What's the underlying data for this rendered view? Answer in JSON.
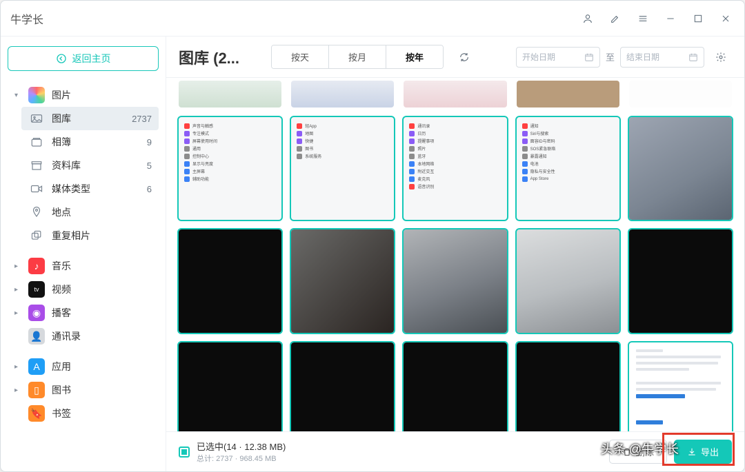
{
  "app_name": "牛学长",
  "back_button": "返回主页",
  "sidebar": {
    "photos_section": "图片",
    "items": [
      {
        "label": "图库",
        "count": "2737"
      },
      {
        "label": "相簿",
        "count": "9"
      },
      {
        "label": "资料库",
        "count": "5"
      },
      {
        "label": "媒体类型",
        "count": "6"
      },
      {
        "label": "地点",
        "count": ""
      },
      {
        "label": "重复相片",
        "count": ""
      }
    ],
    "music": "音乐",
    "video": "视频",
    "podcast": "播客",
    "contacts": "通讯录",
    "apps": "应用",
    "books": "图书",
    "bookmarks": "书签"
  },
  "toolbar": {
    "title": "图库 (2...",
    "seg": {
      "day": "按天",
      "month": "按月",
      "year": "按年"
    },
    "date_start": "开始日期",
    "date_to": "至",
    "date_end": "结束日期"
  },
  "statusbar": {
    "selected": "已选中(14 · 12.38 MB)",
    "total": "总计: 2737 · 968.45 MB",
    "delete": "删除",
    "export": "导出"
  },
  "watermark": "头条 @牛学长",
  "settings_rows": {
    "card1": [
      "声音与触感",
      "专注模式",
      "屏幕使用时间",
      "通用",
      "控制中心",
      "显示与亮度",
      "主屏幕",
      "辅助功能"
    ],
    "card2": [
      "轻App",
      "地图",
      "快捷",
      "图书",
      "系统服务"
    ],
    "card3": [
      "通讯录",
      "日历",
      "提醒事项",
      "照片",
      "蓝牙",
      "本地网络",
      "附近交互",
      "麦克风",
      "语音识别"
    ],
    "card4": [
      "通知",
      "Siri与搜索",
      "面容ID与密码",
      "SOS紧急联络",
      "暴露通知",
      "电池",
      "隐私与安全性",
      "App Store"
    ]
  }
}
